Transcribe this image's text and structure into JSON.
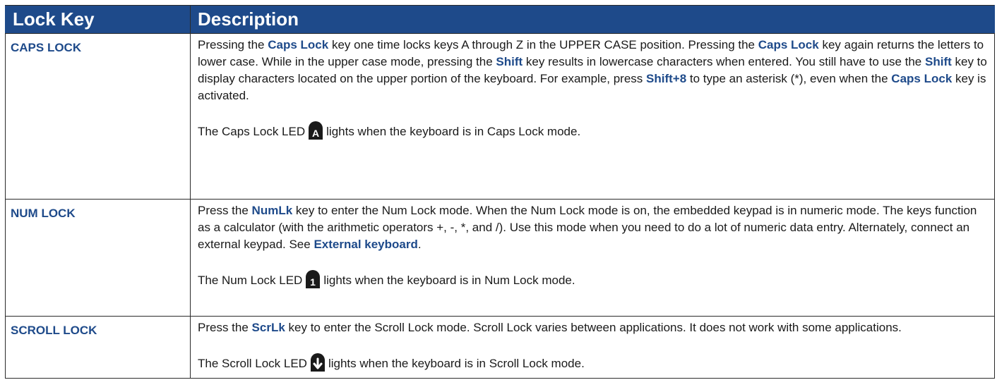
{
  "header": {
    "col_key": "Lock Key",
    "col_desc": "Description"
  },
  "rows": [
    {
      "key": "CAPS LOCK",
      "desc": {
        "t1": "Pressing the ",
        "e1": "Caps Lock",
        "t2": " key one time locks keys A through Z in the UPPER CASE position. Pressing the ",
        "e2": "Caps Lock",
        "t3": " key again returns the letters to lower case. While in the upper case mode, pressing the ",
        "e3": "Shift",
        "t4": " key results in lowercase characters when entered. You still have to use the ",
        "e4": "Shift",
        "t5": " key to display characters located on the upper portion of the keyboard. For example, press ",
        "e5": "Shift+8",
        "t6": " to type an asterisk (*), even when the ",
        "e6": "Caps Lock",
        "t7": " key is activated."
      },
      "led": {
        "before": "The Caps Lock LED",
        "after": "lights when the keyboard is in Caps Lock mode.",
        "icon": "caps-lock-led-icon",
        "icon_glyph": "A"
      }
    },
    {
      "key": "NUM LOCK",
      "desc": {
        "t1": "Press the ",
        "e1": "NumLk",
        "t2": " key to enter the Num Lock mode. When the Num Lock mode is on, the embedded keypad is in numeric mode. The keys function as a calculator (with the arithmetic operators +, -, *, and /). Use this mode when you need to do a lot of numeric data entry. Alternately, connect an external keypad. See ",
        "e2": "External keyboard",
        "t3": "."
      },
      "led": {
        "before": "The Num Lock LED",
        "after": "lights when the keyboard is in Num Lock mode.",
        "icon": "num-lock-led-icon",
        "icon_glyph": "1"
      }
    },
    {
      "key": "SCROLL LOCK",
      "desc": {
        "t1": "Press the ",
        "e1": "ScrLk",
        "t2": " key to enter the Scroll Lock mode. Scroll Lock varies between applications. It does not work with some applications."
      },
      "led": {
        "before": "The Scroll Lock LED",
        "after": "lights when the keyboard is in Scroll Lock mode.",
        "icon": "scroll-lock-led-icon"
      }
    }
  ],
  "colors": {
    "accent": "#1e4a8a",
    "text": "#1a1a1a",
    "border": "#2a2a2a"
  }
}
